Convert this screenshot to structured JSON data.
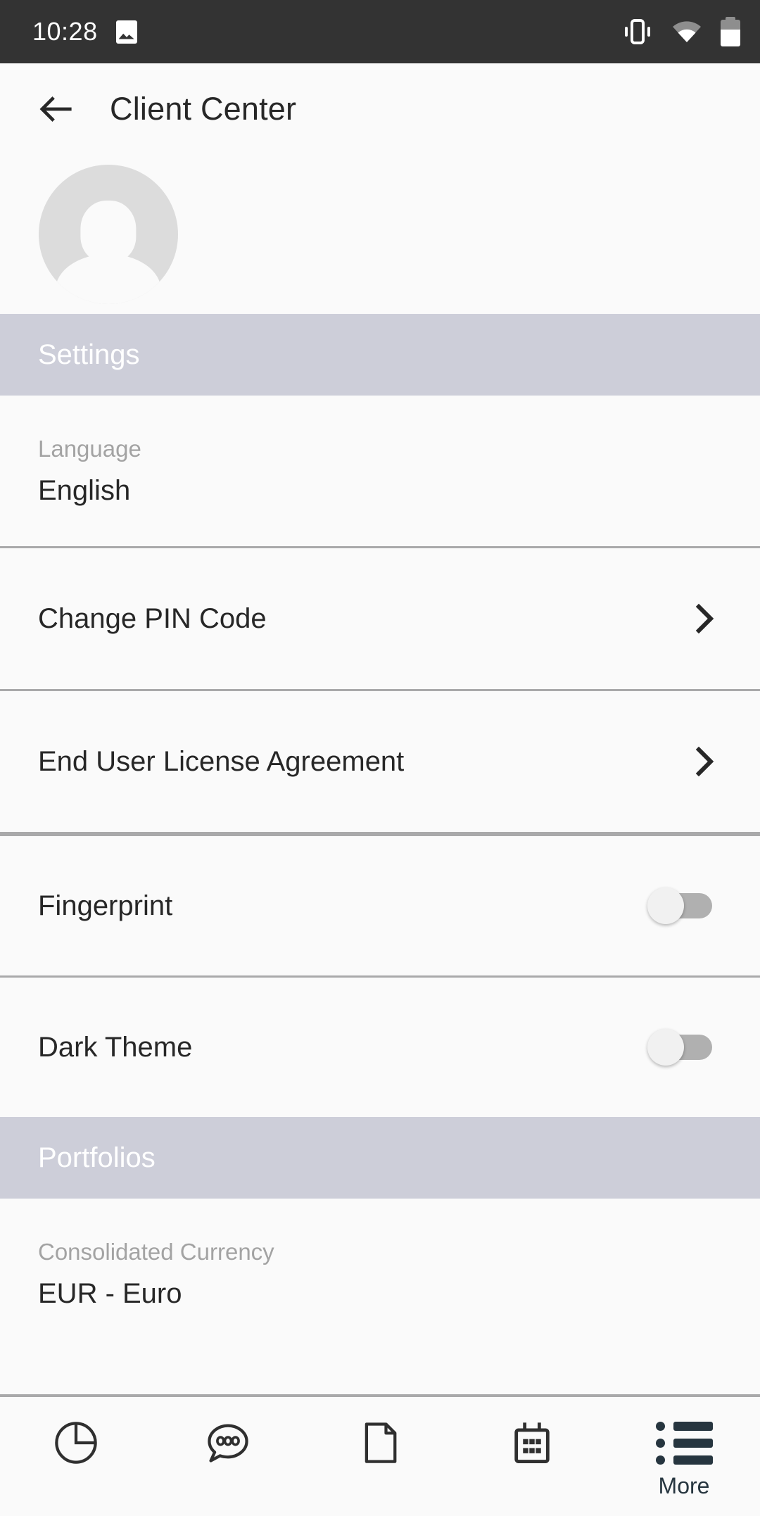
{
  "statusbar": {
    "time": "10:28",
    "icons": {
      "photo": "photo-icon",
      "vibrate": "vibrate-icon",
      "wifi": "wifi-icon",
      "battery": "battery-icon"
    }
  },
  "appbar": {
    "back": "back-arrow-icon",
    "title": "Client Center"
  },
  "profile": {
    "avatar": "avatar-placeholder-icon"
  },
  "sections": [
    {
      "header": "Settings",
      "rows": [
        {
          "type": "value",
          "label": "Language",
          "value": "English"
        },
        {
          "type": "link",
          "title": "Change PIN Code",
          "chevron": "chevron-right-icon"
        },
        {
          "type": "link",
          "title": "End User License Agreement",
          "chevron": "chevron-right-icon"
        },
        {
          "type": "switch",
          "title": "Fingerprint",
          "state": "off"
        },
        {
          "type": "switch",
          "title": "Dark Theme",
          "state": "off"
        }
      ]
    },
    {
      "header": "Portfolios",
      "rows": [
        {
          "type": "value",
          "label": "Consolidated Currency",
          "value": "EUR - Euro"
        }
      ]
    }
  ],
  "bottomnav": {
    "active": "More",
    "items": [
      {
        "icon": "pie-chart-icon",
        "label": ""
      },
      {
        "icon": "chat-bubble-icon",
        "label": ""
      },
      {
        "icon": "document-page-icon",
        "label": ""
      },
      {
        "icon": "calendar-icon",
        "label": ""
      },
      {
        "icon": "more-list-icon",
        "label": "More"
      }
    ]
  },
  "colors": {
    "statusbar_bg": "#333333",
    "page_bg": "#fafafa",
    "section_header_bg": "#cdced9",
    "section_header_text": "#ffffff",
    "primary_text": "#272727",
    "muted_text": "#a3a3a3",
    "divider": "#a9a9aa",
    "accent": "#26353f",
    "switch_track_off": "#b0b0b0",
    "switch_thumb": "#f1f1f1",
    "avatar_bg": "#dcdcdc"
  }
}
